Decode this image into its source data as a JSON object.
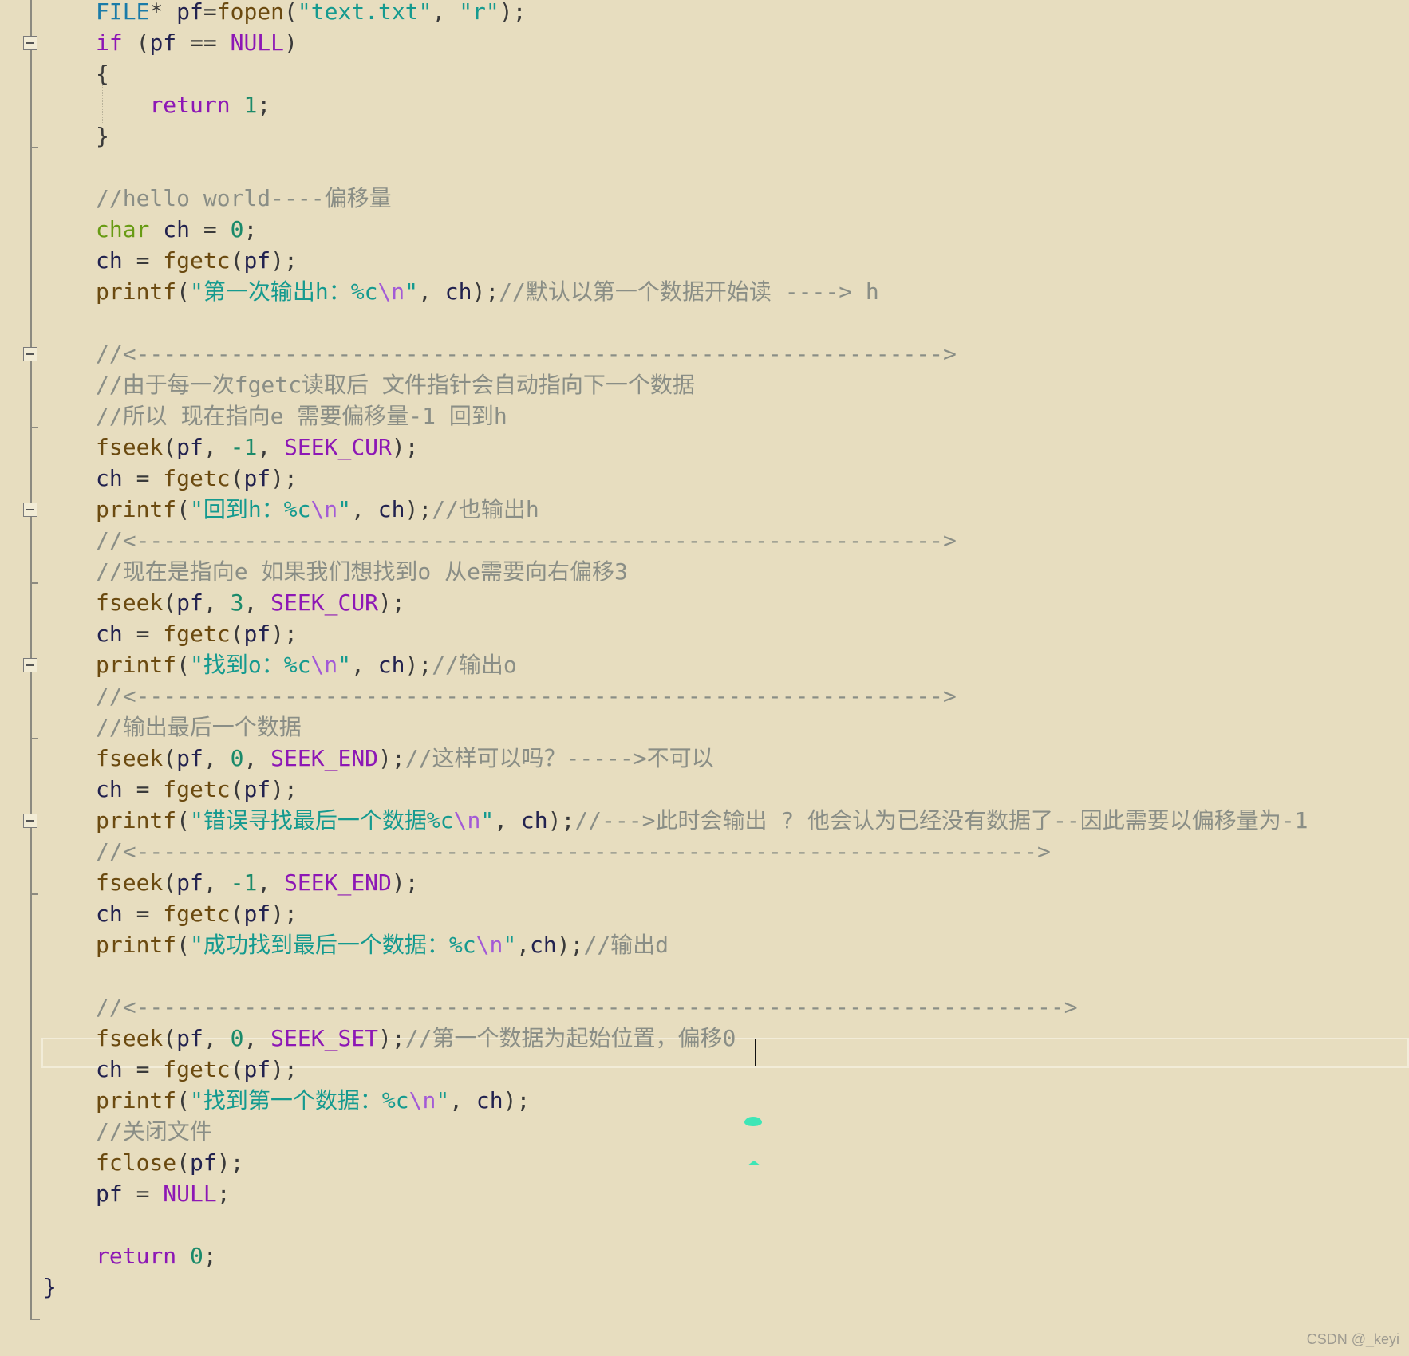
{
  "editor": {
    "lines": [
      [
        [
          "t-type",
          "FILE"
        ],
        [
          "t-pun",
          "* "
        ],
        [
          "t-id",
          "pf"
        ],
        [
          "t-pun",
          "="
        ],
        [
          "t-fn",
          "fopen"
        ],
        [
          "t-pun",
          "("
        ],
        [
          "t-str",
          "\"text.txt\""
        ],
        [
          "t-pun",
          ", "
        ],
        [
          "t-str",
          "\"r\""
        ],
        [
          "t-pun",
          ");"
        ]
      ],
      [
        [
          "t-kw",
          "if"
        ],
        [
          "t-pun",
          " ("
        ],
        [
          "t-id",
          "pf"
        ],
        [
          "t-pun",
          " == "
        ],
        [
          "t-mac",
          "NULL"
        ],
        [
          "t-pun",
          ")"
        ]
      ],
      [
        [
          "t-pun",
          "{"
        ]
      ],
      [
        [
          "t-pun",
          "    "
        ],
        [
          "t-kw",
          "return"
        ],
        [
          "t-pun",
          " "
        ],
        [
          "t-num",
          "1"
        ],
        [
          "t-pun",
          ";"
        ]
      ],
      [
        [
          "t-pun",
          "}"
        ]
      ],
      [],
      [
        [
          "t-com",
          "//hello world----偏移量"
        ]
      ],
      [
        [
          "t-char",
          "char"
        ],
        [
          "t-pun",
          " "
        ],
        [
          "t-id",
          "ch"
        ],
        [
          "t-pun",
          " = "
        ],
        [
          "t-num",
          "0"
        ],
        [
          "t-pun",
          ";"
        ]
      ],
      [
        [
          "t-id",
          "ch"
        ],
        [
          "t-pun",
          " = "
        ],
        [
          "t-fn",
          "fgetc"
        ],
        [
          "t-pun",
          "("
        ],
        [
          "t-id",
          "pf"
        ],
        [
          "t-pun",
          ");"
        ]
      ],
      [
        [
          "t-fn",
          "printf"
        ],
        [
          "t-pun",
          "("
        ],
        [
          "t-str",
          "\"第一次输出h：%c"
        ],
        [
          "t-esc",
          "\\n"
        ],
        [
          "t-str",
          "\""
        ],
        [
          "t-pun",
          ", "
        ],
        [
          "t-id",
          "ch"
        ],
        [
          "t-pun",
          ");"
        ],
        [
          "t-com",
          "//默认以第一个数据开始读 ----> h"
        ]
      ],
      [],
      [
        [
          "t-com",
          "//<------------------------------------------------------------>"
        ]
      ],
      [
        [
          "t-com",
          "//由于每一次fgetc读取后 文件指针会自动指向下一个数据"
        ]
      ],
      [
        [
          "t-com",
          "//所以 现在指向e 需要偏移量-1 回到h"
        ]
      ],
      [
        [
          "t-fn",
          "fseek"
        ],
        [
          "t-pun",
          "("
        ],
        [
          "t-id",
          "pf"
        ],
        [
          "t-pun",
          ", "
        ],
        [
          "t-num",
          "-1"
        ],
        [
          "t-pun",
          ", "
        ],
        [
          "t-mac",
          "SEEK_CUR"
        ],
        [
          "t-pun",
          ");"
        ]
      ],
      [
        [
          "t-id",
          "ch"
        ],
        [
          "t-pun",
          " = "
        ],
        [
          "t-fn",
          "fgetc"
        ],
        [
          "t-pun",
          "("
        ],
        [
          "t-id",
          "pf"
        ],
        [
          "t-pun",
          ");"
        ]
      ],
      [
        [
          "t-fn",
          "printf"
        ],
        [
          "t-pun",
          "("
        ],
        [
          "t-str",
          "\"回到h：%c"
        ],
        [
          "t-esc",
          "\\n"
        ],
        [
          "t-str",
          "\""
        ],
        [
          "t-pun",
          ", "
        ],
        [
          "t-id",
          "ch"
        ],
        [
          "t-pun",
          ");"
        ],
        [
          "t-com",
          "//也输出h"
        ]
      ],
      [
        [
          "t-com",
          "//<------------------------------------------------------------>"
        ]
      ],
      [
        [
          "t-com",
          "//现在是指向e 如果我们想找到o 从e需要向右偏移3"
        ]
      ],
      [
        [
          "t-fn",
          "fseek"
        ],
        [
          "t-pun",
          "("
        ],
        [
          "t-id",
          "pf"
        ],
        [
          "t-pun",
          ", "
        ],
        [
          "t-num",
          "3"
        ],
        [
          "t-pun",
          ", "
        ],
        [
          "t-mac",
          "SEEK_CUR"
        ],
        [
          "t-pun",
          ");"
        ]
      ],
      [
        [
          "t-id",
          "ch"
        ],
        [
          "t-pun",
          " = "
        ],
        [
          "t-fn",
          "fgetc"
        ],
        [
          "t-pun",
          "("
        ],
        [
          "t-id",
          "pf"
        ],
        [
          "t-pun",
          ");"
        ]
      ],
      [
        [
          "t-fn",
          "printf"
        ],
        [
          "t-pun",
          "("
        ],
        [
          "t-str",
          "\"找到o：%c"
        ],
        [
          "t-esc",
          "\\n"
        ],
        [
          "t-str",
          "\""
        ],
        [
          "t-pun",
          ", "
        ],
        [
          "t-id",
          "ch"
        ],
        [
          "t-pun",
          ");"
        ],
        [
          "t-com",
          "//输出o"
        ]
      ],
      [
        [
          "t-com",
          "//<------------------------------------------------------------>"
        ]
      ],
      [
        [
          "t-com",
          "//输出最后一个数据"
        ]
      ],
      [
        [
          "t-fn",
          "fseek"
        ],
        [
          "t-pun",
          "("
        ],
        [
          "t-id",
          "pf"
        ],
        [
          "t-pun",
          ", "
        ],
        [
          "t-num",
          "0"
        ],
        [
          "t-pun",
          ", "
        ],
        [
          "t-mac",
          "SEEK_END"
        ],
        [
          "t-pun",
          ");"
        ],
        [
          "t-com",
          "//这样可以吗？----->不可以"
        ]
      ],
      [
        [
          "t-id",
          "ch"
        ],
        [
          "t-pun",
          " = "
        ],
        [
          "t-fn",
          "fgetc"
        ],
        [
          "t-pun",
          "("
        ],
        [
          "t-id",
          "pf"
        ],
        [
          "t-pun",
          ");"
        ]
      ],
      [
        [
          "t-fn",
          "printf"
        ],
        [
          "t-pun",
          "("
        ],
        [
          "t-str",
          "\"错误寻找最后一个数据%c"
        ],
        [
          "t-esc",
          "\\n"
        ],
        [
          "t-str",
          "\""
        ],
        [
          "t-pun",
          ", "
        ],
        [
          "t-id",
          "ch"
        ],
        [
          "t-pun",
          ");"
        ],
        [
          "t-com",
          "//--->此时会输出 ? 他会认为已经没有数据了--因此需要以偏移量为-1"
        ]
      ],
      [
        [
          "t-com",
          "//<------------------------------------------------------------------->"
        ]
      ],
      [
        [
          "t-fn",
          "fseek"
        ],
        [
          "t-pun",
          "("
        ],
        [
          "t-id",
          "pf"
        ],
        [
          "t-pun",
          ", "
        ],
        [
          "t-num",
          "-1"
        ],
        [
          "t-pun",
          ", "
        ],
        [
          "t-mac",
          "SEEK_END"
        ],
        [
          "t-pun",
          ");"
        ]
      ],
      [
        [
          "t-id",
          "ch"
        ],
        [
          "t-pun",
          " = "
        ],
        [
          "t-fn",
          "fgetc"
        ],
        [
          "t-pun",
          "("
        ],
        [
          "t-id",
          "pf"
        ],
        [
          "t-pun",
          ");"
        ]
      ],
      [
        [
          "t-fn",
          "printf"
        ],
        [
          "t-pun",
          "("
        ],
        [
          "t-str",
          "\"成功找到最后一个数据：%c"
        ],
        [
          "t-esc",
          "\\n"
        ],
        [
          "t-str",
          "\""
        ],
        [
          "t-pun",
          ","
        ],
        [
          "t-id",
          "ch"
        ],
        [
          "t-pun",
          ");"
        ],
        [
          "t-com",
          "//输出d"
        ]
      ],
      [],
      [
        [
          "t-com",
          "//<--------------------------------------------------------------------->"
        ]
      ],
      [
        [
          "t-fn",
          "fseek"
        ],
        [
          "t-pun",
          "("
        ],
        [
          "t-id",
          "pf"
        ],
        [
          "t-pun",
          ", "
        ],
        [
          "t-num",
          "0"
        ],
        [
          "t-pun",
          ", "
        ],
        [
          "t-mac",
          "SEEK_SET"
        ],
        [
          "t-pun",
          ");"
        ],
        [
          "t-com",
          "//第一个数据为起始位置，偏移0"
        ]
      ],
      [
        [
          "t-id",
          "ch"
        ],
        [
          "t-pun",
          " = "
        ],
        [
          "t-fn",
          "fgetc"
        ],
        [
          "t-pun",
          "("
        ],
        [
          "t-id",
          "pf"
        ],
        [
          "t-pun",
          ");"
        ]
      ],
      [
        [
          "t-fn",
          "printf"
        ],
        [
          "t-pun",
          "("
        ],
        [
          "t-str",
          "\"找到第一个数据：%c"
        ],
        [
          "t-esc",
          "\\n"
        ],
        [
          "t-str",
          "\""
        ],
        [
          "t-pun",
          ", "
        ],
        [
          "t-id",
          "ch"
        ],
        [
          "t-pun",
          ");"
        ]
      ],
      [
        [
          "t-com",
          "//关闭文件"
        ]
      ],
      [
        [
          "t-fn",
          "fclose"
        ],
        [
          "t-pun",
          "("
        ],
        [
          "t-id",
          "pf"
        ],
        [
          "t-pun",
          ");"
        ]
      ],
      [
        [
          "t-id",
          "pf"
        ],
        [
          "t-pun",
          " = "
        ],
        [
          "t-mac",
          "NULL"
        ],
        [
          "t-pun",
          ";"
        ]
      ],
      [],
      [
        [
          "t-kw",
          "return"
        ],
        [
          "t-pun",
          " "
        ],
        [
          "t-num",
          "0"
        ],
        [
          "t-pun",
          ";"
        ]
      ]
    ],
    "closing_brace": "}",
    "fold_markers_at_lines": [
      1,
      11,
      16,
      21,
      26
    ],
    "current_line": 33
  },
  "watermark": "CSDN @_keyi",
  "colors": {
    "background": "#e7ddbf",
    "comment": "#8a8e86",
    "string": "#159a8f",
    "keyword": "#8d17b5",
    "macro": "#8d17b5",
    "type": "#1a7ba8",
    "number": "#1b8a6a"
  }
}
